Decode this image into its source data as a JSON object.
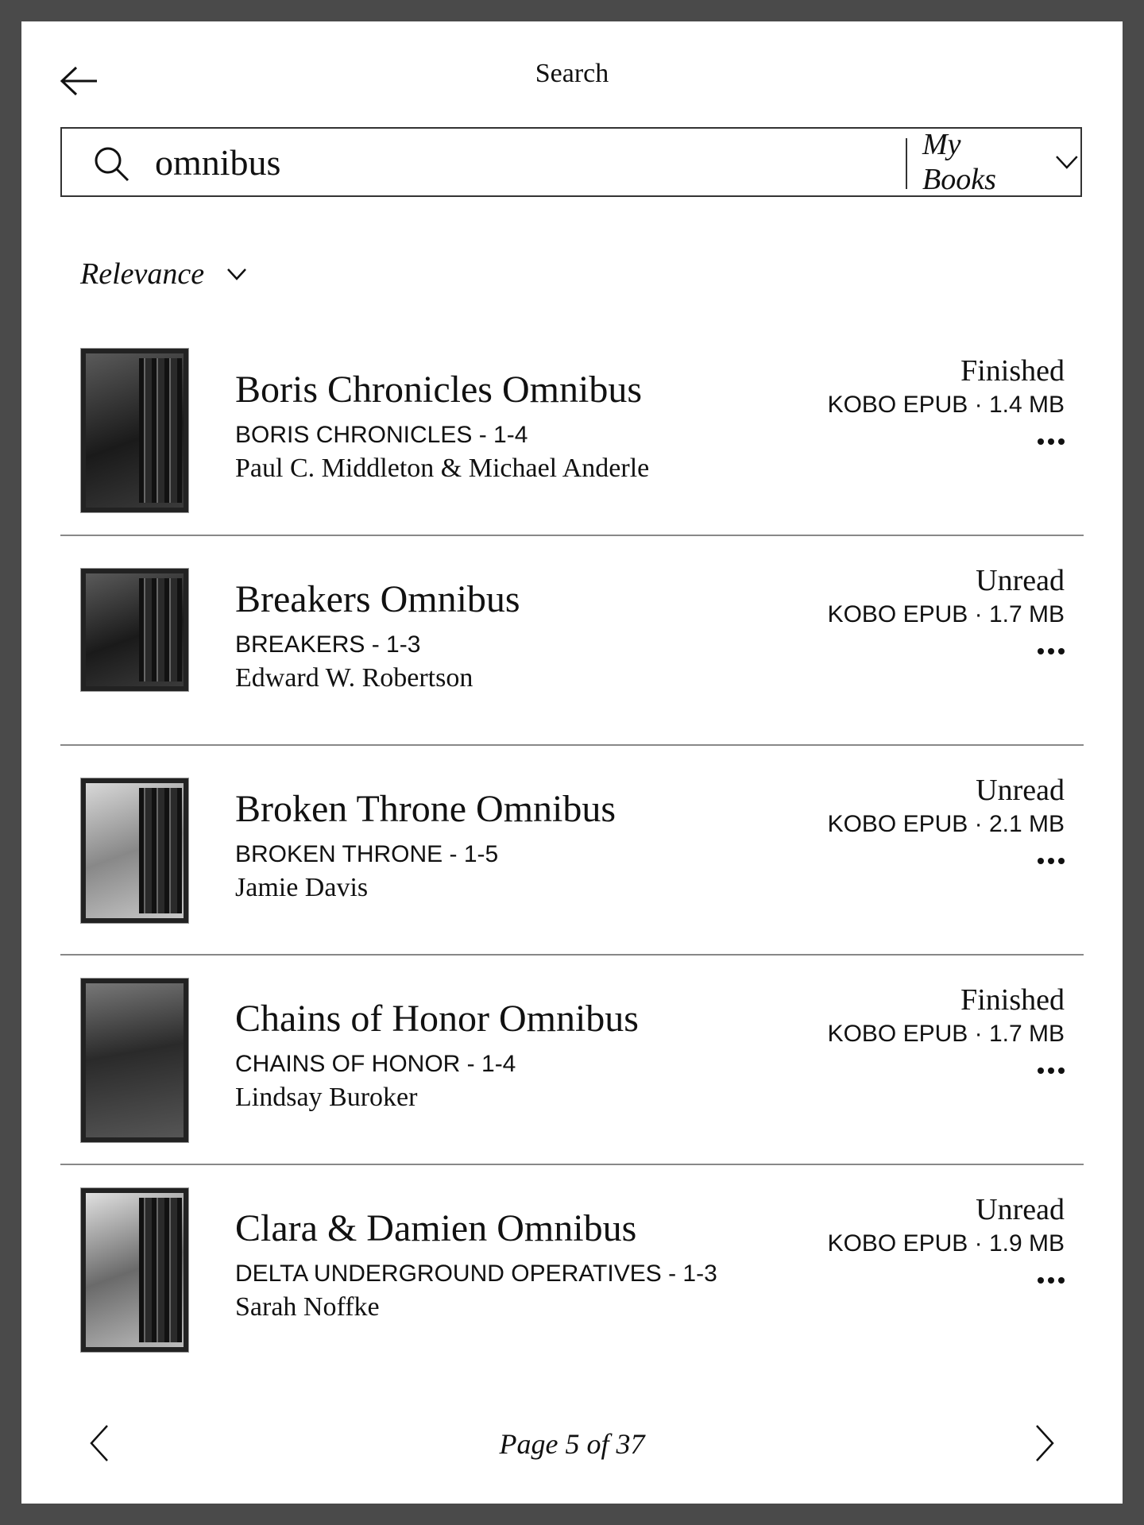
{
  "header": {
    "title": "Search",
    "back_icon": "arrow-left-icon"
  },
  "search": {
    "query": "omnibus",
    "placeholder": "",
    "scope": "My Books"
  },
  "sort": {
    "selected": "Relevance"
  },
  "results": [
    {
      "title": "Boris Chronicles Omnibus",
      "series": "BORIS CHRONICLES - 1-4",
      "author": "Paul C. Middleton & Michael Anderle",
      "status": "Finished",
      "format": "KOBO EPUB · 1.4 MB"
    },
    {
      "title": "Breakers Omnibus",
      "series": "BREAKERS - 1-3",
      "author": "Edward W. Robertson",
      "status": "Unread",
      "format": "KOBO EPUB · 1.7 MB"
    },
    {
      "title": "Broken Throne Omnibus",
      "series": "BROKEN THRONE - 1-5",
      "author": "Jamie Davis",
      "status": "Unread",
      "format": "KOBO EPUB · 2.1 MB"
    },
    {
      "title": "Chains of Honor Omnibus",
      "series": "CHAINS OF HONOR - 1-4",
      "author": "Lindsay Buroker",
      "status": "Finished",
      "format": "KOBO EPUB · 1.7 MB"
    },
    {
      "title": "Clara & Damien Omnibus",
      "series": "DELTA UNDERGROUND OPERATIVES - 1-3",
      "author": "Sarah Noffke",
      "status": "Unread",
      "format": "KOBO EPUB · 1.9 MB"
    }
  ],
  "pagination": {
    "label": "Page 5 of 37",
    "current": 5,
    "total": 37
  },
  "colors": {
    "frame": "#4a4a4a",
    "background": "#ffffff",
    "text": "#111111",
    "divider": "#888888"
  }
}
